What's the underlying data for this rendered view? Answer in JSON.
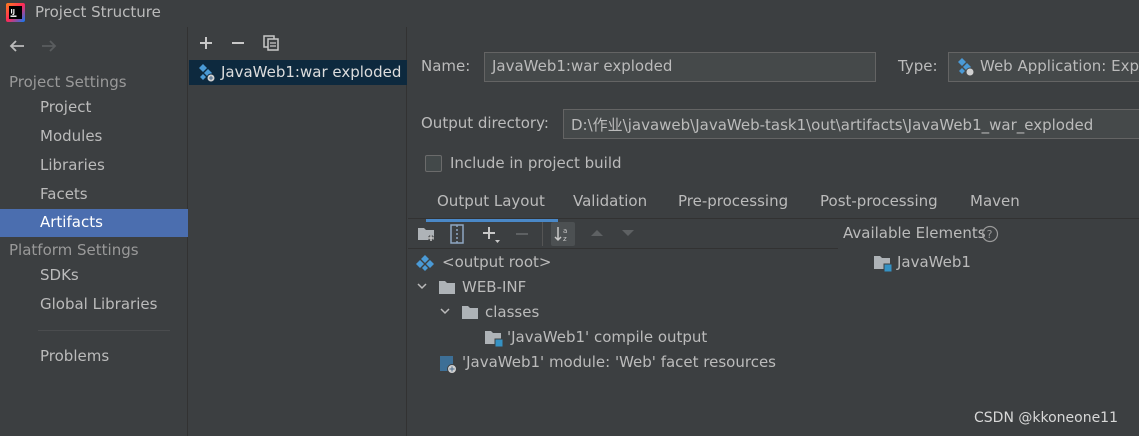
{
  "window": {
    "title": "Project Structure"
  },
  "left_panel": {
    "project_settings_header": "Project Settings",
    "project_settings_items": [
      {
        "label": "Project"
      },
      {
        "label": "Modules"
      },
      {
        "label": "Libraries"
      },
      {
        "label": "Facets"
      },
      {
        "label": "Artifacts"
      }
    ],
    "selected_item": "Artifacts",
    "platform_settings_header": "Platform Settings",
    "platform_settings_items": [
      {
        "label": "SDKs"
      },
      {
        "label": "Global Libraries"
      }
    ],
    "problems_label": "Problems"
  },
  "artifact_list": {
    "items": [
      {
        "label": "JavaWeb1:war exploded"
      }
    ]
  },
  "detail": {
    "name_label": "Name:",
    "name_value": "JavaWeb1:war exploded",
    "type_label": "Type:",
    "type_value": "Web Application: Expl",
    "output_dir_label": "Output directory:",
    "output_dir_value": "D:\\作业\\javaweb\\JavaWeb-task1\\out\\artifacts\\JavaWeb1_war_exploded",
    "include_build_label": "Include in project build",
    "include_build_checked": false,
    "tabs": [
      {
        "label": "Output Layout"
      },
      {
        "label": "Validation"
      },
      {
        "label": "Pre-processing"
      },
      {
        "label": "Post-processing"
      },
      {
        "label": "Maven"
      }
    ],
    "active_tab": "Output Layout",
    "available_elements_label": "Available Elements",
    "tree": [
      {
        "label": "<output root>"
      },
      {
        "label": "WEB-INF"
      },
      {
        "label": "classes"
      },
      {
        "label": "'JavaWeb1' compile output"
      },
      {
        "label": "'JavaWeb1' module: 'Web' facet resources"
      }
    ],
    "available_tree": [
      {
        "label": "JavaWeb1"
      }
    ]
  },
  "watermark": "CSDN @kkoneone11",
  "colors": {
    "background": "#3c3f41",
    "selection": "#4b6eaf",
    "list_selection": "#0d293e",
    "tab_underline": "#4a88c7",
    "text": "#bbbbbb"
  }
}
